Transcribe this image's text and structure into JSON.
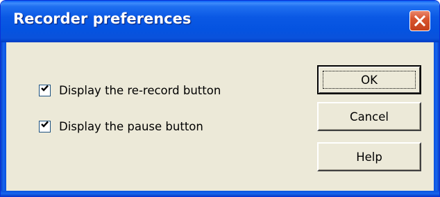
{
  "window": {
    "title": "Recorder preferences"
  },
  "options": [
    {
      "label": "Display the re-record button",
      "checked": true
    },
    {
      "label": "Display the pause button",
      "checked": true
    }
  ],
  "buttons": {
    "ok": "OK",
    "cancel": "Cancel",
    "help": "Help"
  },
  "icons": {
    "close": "close-icon",
    "check": "checkmark-icon"
  },
  "colors": {
    "titlebar": "#0a58e4",
    "close_button": "#d8542e",
    "dialog_background": "#ece9d8"
  }
}
